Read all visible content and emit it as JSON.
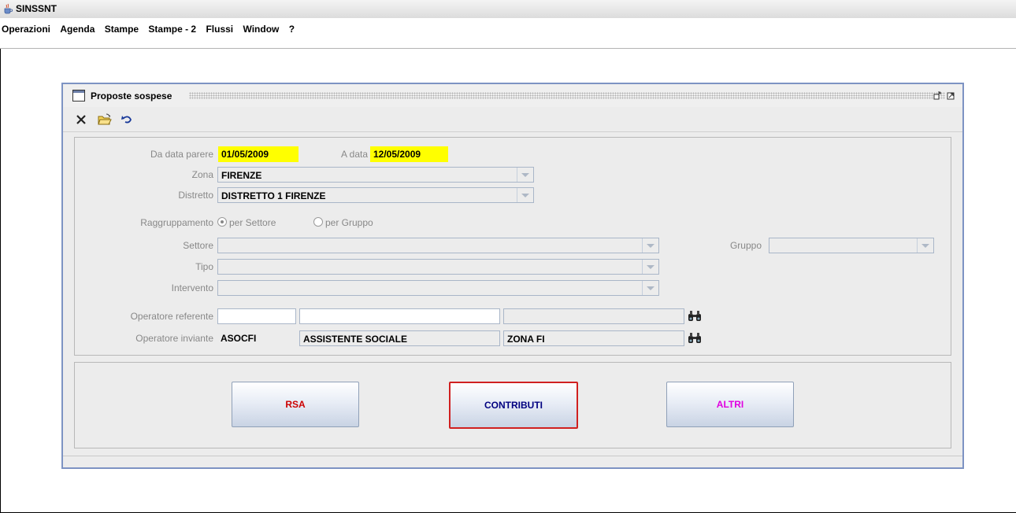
{
  "app": {
    "title": "SINSSNT",
    "icon": "java-cup-icon"
  },
  "menu": [
    {
      "label": "Operazioni"
    },
    {
      "label": "Agenda"
    },
    {
      "label": "Stampe"
    },
    {
      "label": "Stampe - 2"
    },
    {
      "label": "Flussi"
    },
    {
      "label": "Window"
    },
    {
      "label": "?"
    }
  ],
  "window": {
    "title": "Proposte sospese",
    "controls": [
      "restore-icon",
      "maximize-icon"
    ]
  },
  "toolbar": {
    "icons": [
      "close-icon",
      "open-folder-icon",
      "undo-icon"
    ]
  },
  "form": {
    "da_data_label": "Da data parere",
    "da_data_value": "01/05/2009",
    "a_data_label": "A data",
    "a_data_value": "12/05/2009",
    "zona_label": "Zona",
    "zona_value": "FIRENZE",
    "distretto_label": "Distretto",
    "distretto_value": "DISTRETTO 1 FIRENZE",
    "raggruppamento_label": "Raggruppamento",
    "radio_settore": "per Settore",
    "radio_gruppo": "per Gruppo",
    "raggruppamento_selected": "per Settore",
    "settore_label": "Settore",
    "settore_value": "",
    "gruppo_label": "Gruppo",
    "gruppo_value": "",
    "tipo_label": "Tipo",
    "tipo_value": "",
    "intervento_label": "Intervento",
    "intervento_value": "",
    "op_referente_label": "Operatore referente",
    "op_referente_code": "",
    "op_referente_desc": "",
    "op_referente_zona": "",
    "op_inviante_label": "Operatore inviante",
    "op_inviante_code": "ASOCFI",
    "op_inviante_desc": "ASSISTENTE SOCIALE",
    "op_inviante_zona": "ZONA FI"
  },
  "buttons": {
    "rsa": {
      "label": "RSA",
      "color": "#cc0000"
    },
    "contributi": {
      "label": "CONTRIBUTI",
      "color": "#000080"
    },
    "altri": {
      "label": "ALTRI",
      "color": "#e000e0"
    }
  },
  "colors": {
    "date_highlight": "#ffff00",
    "frame_border": "#7d93c3",
    "focus_border": "#d02020"
  }
}
